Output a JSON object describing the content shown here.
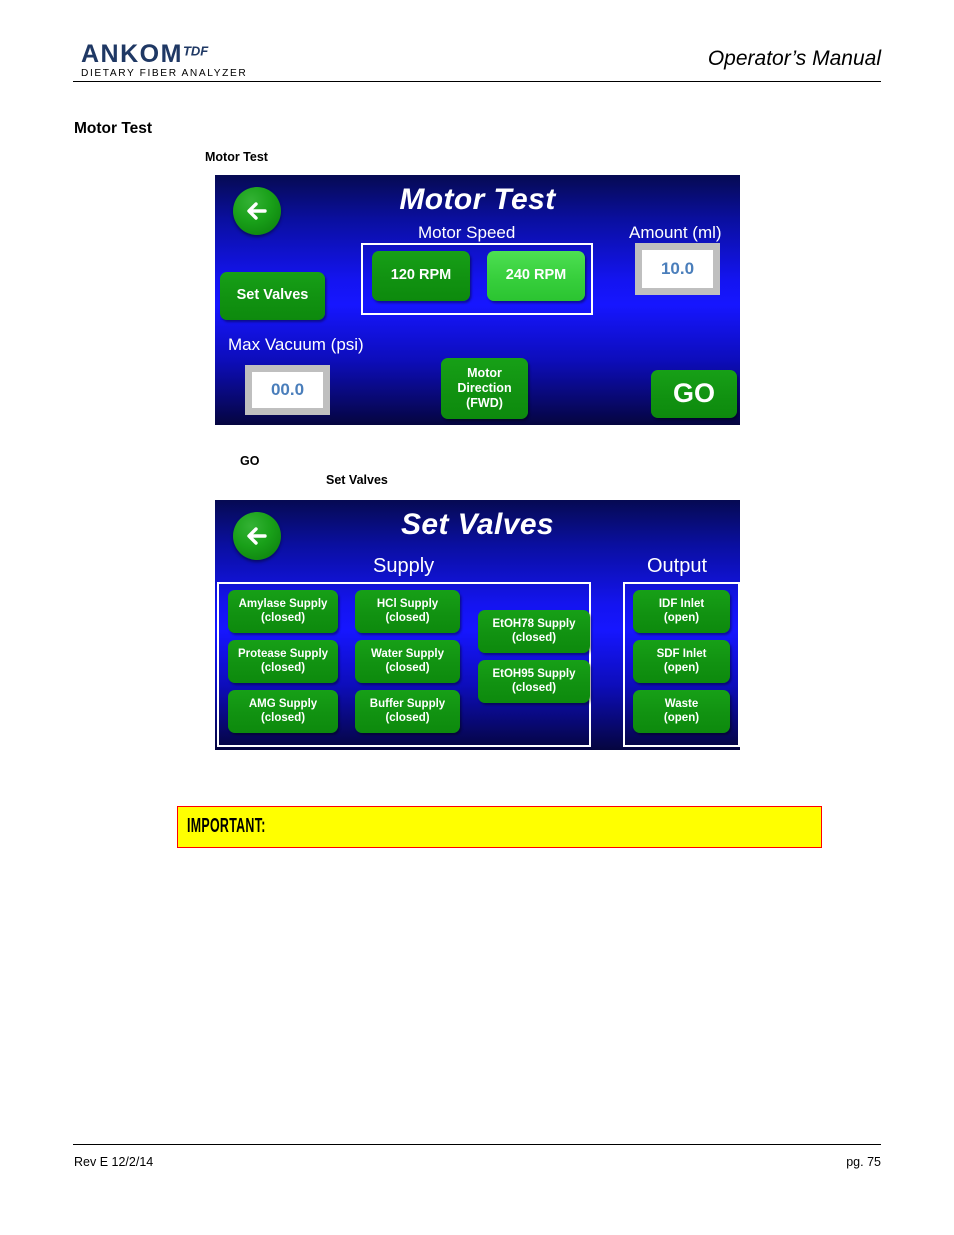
{
  "header": {
    "logo_main": "ANKOM",
    "logo_sup": "TDF",
    "logo_sub": "DIETARY FIBER ANALYZER",
    "manual_title": "Operator’s Manual"
  },
  "section": {
    "heading": "Motor Test"
  },
  "captions": {
    "motor_test": "Motor Test",
    "go": "GO",
    "set_valves": "Set Valves"
  },
  "motor_test_screen": {
    "title": "Motor Test",
    "back_icon": "back-arrow-icon",
    "set_valves_button": "Set Valves",
    "motor_speed_label": "Motor Speed",
    "speed_options": [
      {
        "label": "120 RPM",
        "selected": false
      },
      {
        "label": "240 RPM",
        "selected": true
      }
    ],
    "amount_label": "Amount (ml)",
    "amount_value": "10.0",
    "max_vacuum_label": "Max Vacuum (psi)",
    "max_vacuum_value": "00.0",
    "motor_direction_button": "Motor\nDirection\n(FWD)",
    "motor_direction_line1": "Motor",
    "motor_direction_line2": "Direction",
    "motor_direction_line3": "(FWD)",
    "go_button": "GO"
  },
  "set_valves_screen": {
    "title": "Set Valves",
    "back_icon": "back-arrow-icon",
    "supply_label": "Supply",
    "output_label": "Output",
    "supply_column_1": [
      {
        "name": "Amylase Supply",
        "state": "(closed)"
      },
      {
        "name": "Protease Supply",
        "state": "(closed)"
      },
      {
        "name": "AMG Supply",
        "state": "(closed)"
      }
    ],
    "supply_column_2": [
      {
        "name": "HCl Supply",
        "state": "(closed)"
      },
      {
        "name": "Water Supply",
        "state": "(closed)"
      },
      {
        "name": "Buffer Supply",
        "state": "(closed)"
      }
    ],
    "supply_column_3": [
      {
        "name": "EtOH78 Supply",
        "state": "(closed)"
      },
      {
        "name": "EtOH95 Supply",
        "state": "(closed)"
      }
    ],
    "output_column": [
      {
        "name": "IDF Inlet",
        "state": "(open)"
      },
      {
        "name": "SDF Inlet",
        "state": "(open)"
      },
      {
        "name": "Waste",
        "state": "(open)"
      }
    ]
  },
  "important": {
    "label": "IMPORTANT:"
  },
  "footer": {
    "left": "Rev E 12/2/14",
    "right": "pg. 75"
  },
  "colors": {
    "brand_blue": "#1f3864",
    "panel_blue": "#1616ff",
    "panel_dark": "#05053f",
    "button_green": "#119211",
    "button_green_selected": "#37cf3c",
    "value_text_blue": "#4a7ebb",
    "important_fill": "#ffff00",
    "important_border": "#ff0000"
  }
}
